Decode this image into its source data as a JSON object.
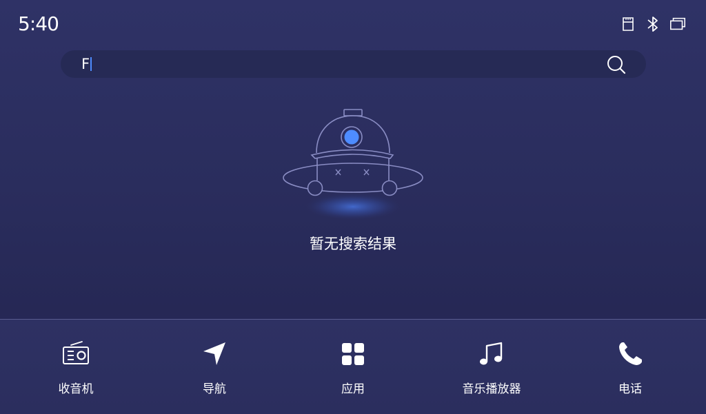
{
  "status_bar": {
    "time": "5:40",
    "icons": [
      "sd-card-icon",
      "bluetooth-icon",
      "windows-icon"
    ]
  },
  "search": {
    "value": "F",
    "icon": "search-icon"
  },
  "empty_state": {
    "message": "暂无搜索结果",
    "illustration": "ufo-robot-icon"
  },
  "dock": {
    "items": [
      {
        "label": "收音机",
        "icon": "radio-icon"
      },
      {
        "label": "导航",
        "icon": "navigation-icon"
      },
      {
        "label": "应用",
        "icon": "apps-grid-icon"
      },
      {
        "label": "音乐播放器",
        "icon": "music-note-icon"
      },
      {
        "label": "电话",
        "icon": "phone-icon"
      }
    ]
  },
  "colors": {
    "background": "#2a2d5d",
    "search_bar": "#262a55",
    "accent_blue": "#4e8cff",
    "outline": "#8a8dc4"
  }
}
